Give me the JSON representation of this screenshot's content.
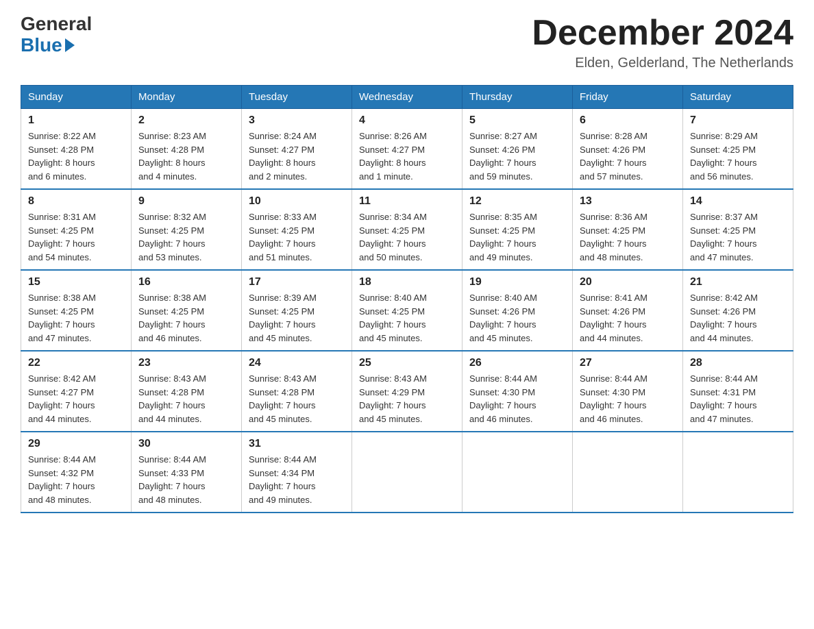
{
  "logo": {
    "line1": "General",
    "line2": "Blue"
  },
  "header": {
    "title": "December 2024",
    "subtitle": "Elden, Gelderland, The Netherlands"
  },
  "weekdays": [
    "Sunday",
    "Monday",
    "Tuesday",
    "Wednesday",
    "Thursday",
    "Friday",
    "Saturday"
  ],
  "weeks": [
    [
      {
        "day": "1",
        "sunrise": "8:22 AM",
        "sunset": "4:28 PM",
        "daylight": "8 hours and 6 minutes."
      },
      {
        "day": "2",
        "sunrise": "8:23 AM",
        "sunset": "4:28 PM",
        "daylight": "8 hours and 4 minutes."
      },
      {
        "day": "3",
        "sunrise": "8:24 AM",
        "sunset": "4:27 PM",
        "daylight": "8 hours and 2 minutes."
      },
      {
        "day": "4",
        "sunrise": "8:26 AM",
        "sunset": "4:27 PM",
        "daylight": "8 hours and 1 minute."
      },
      {
        "day": "5",
        "sunrise": "8:27 AM",
        "sunset": "4:26 PM",
        "daylight": "7 hours and 59 minutes."
      },
      {
        "day": "6",
        "sunrise": "8:28 AM",
        "sunset": "4:26 PM",
        "daylight": "7 hours and 57 minutes."
      },
      {
        "day": "7",
        "sunrise": "8:29 AM",
        "sunset": "4:25 PM",
        "daylight": "7 hours and 56 minutes."
      }
    ],
    [
      {
        "day": "8",
        "sunrise": "8:31 AM",
        "sunset": "4:25 PM",
        "daylight": "7 hours and 54 minutes."
      },
      {
        "day": "9",
        "sunrise": "8:32 AM",
        "sunset": "4:25 PM",
        "daylight": "7 hours and 53 minutes."
      },
      {
        "day": "10",
        "sunrise": "8:33 AM",
        "sunset": "4:25 PM",
        "daylight": "7 hours and 51 minutes."
      },
      {
        "day": "11",
        "sunrise": "8:34 AM",
        "sunset": "4:25 PM",
        "daylight": "7 hours and 50 minutes."
      },
      {
        "day": "12",
        "sunrise": "8:35 AM",
        "sunset": "4:25 PM",
        "daylight": "7 hours and 49 minutes."
      },
      {
        "day": "13",
        "sunrise": "8:36 AM",
        "sunset": "4:25 PM",
        "daylight": "7 hours and 48 minutes."
      },
      {
        "day": "14",
        "sunrise": "8:37 AM",
        "sunset": "4:25 PM",
        "daylight": "7 hours and 47 minutes."
      }
    ],
    [
      {
        "day": "15",
        "sunrise": "8:38 AM",
        "sunset": "4:25 PM",
        "daylight": "7 hours and 47 minutes."
      },
      {
        "day": "16",
        "sunrise": "8:38 AM",
        "sunset": "4:25 PM",
        "daylight": "7 hours and 46 minutes."
      },
      {
        "day": "17",
        "sunrise": "8:39 AM",
        "sunset": "4:25 PM",
        "daylight": "7 hours and 45 minutes."
      },
      {
        "day": "18",
        "sunrise": "8:40 AM",
        "sunset": "4:25 PM",
        "daylight": "7 hours and 45 minutes."
      },
      {
        "day": "19",
        "sunrise": "8:40 AM",
        "sunset": "4:26 PM",
        "daylight": "7 hours and 45 minutes."
      },
      {
        "day": "20",
        "sunrise": "8:41 AM",
        "sunset": "4:26 PM",
        "daylight": "7 hours and 44 minutes."
      },
      {
        "day": "21",
        "sunrise": "8:42 AM",
        "sunset": "4:26 PM",
        "daylight": "7 hours and 44 minutes."
      }
    ],
    [
      {
        "day": "22",
        "sunrise": "8:42 AM",
        "sunset": "4:27 PM",
        "daylight": "7 hours and 44 minutes."
      },
      {
        "day": "23",
        "sunrise": "8:43 AM",
        "sunset": "4:28 PM",
        "daylight": "7 hours and 44 minutes."
      },
      {
        "day": "24",
        "sunrise": "8:43 AM",
        "sunset": "4:28 PM",
        "daylight": "7 hours and 45 minutes."
      },
      {
        "day": "25",
        "sunrise": "8:43 AM",
        "sunset": "4:29 PM",
        "daylight": "7 hours and 45 minutes."
      },
      {
        "day": "26",
        "sunrise": "8:44 AM",
        "sunset": "4:30 PM",
        "daylight": "7 hours and 46 minutes."
      },
      {
        "day": "27",
        "sunrise": "8:44 AM",
        "sunset": "4:30 PM",
        "daylight": "7 hours and 46 minutes."
      },
      {
        "day": "28",
        "sunrise": "8:44 AM",
        "sunset": "4:31 PM",
        "daylight": "7 hours and 47 minutes."
      }
    ],
    [
      {
        "day": "29",
        "sunrise": "8:44 AM",
        "sunset": "4:32 PM",
        "daylight": "7 hours and 48 minutes."
      },
      {
        "day": "30",
        "sunrise": "8:44 AM",
        "sunset": "4:33 PM",
        "daylight": "7 hours and 48 minutes."
      },
      {
        "day": "31",
        "sunrise": "8:44 AM",
        "sunset": "4:34 PM",
        "daylight": "7 hours and 49 minutes."
      },
      null,
      null,
      null,
      null
    ]
  ]
}
